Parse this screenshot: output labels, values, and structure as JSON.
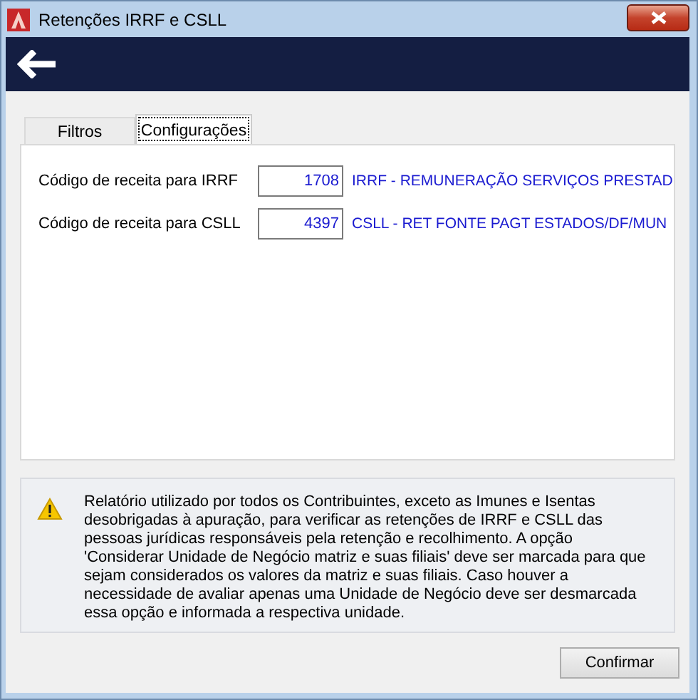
{
  "window": {
    "title": "Retenções IRRF e CSLL"
  },
  "tabs": [
    {
      "label": "Filtros",
      "selected": false
    },
    {
      "label": "Configurações",
      "selected": true
    }
  ],
  "fields": [
    {
      "label": "Código de receita para IRRF",
      "value": "1708",
      "description": "IRRF - REMUNERAÇÃO SERVIÇOS PRESTAD"
    },
    {
      "label": "Código de receita para CSLL",
      "value": "4397",
      "description": "CSLL - RET FONTE PAGT ESTADOS/DF/MUN"
    }
  ],
  "info": {
    "text": "Relatório utilizado por todos os Contribuintes, exceto as Imunes e Isentas desobrigadas à apuração, para verificar as retenções de IRRF e CSLL das pessoas jurídicas responsáveis pela retenção e recolhimento. A opção 'Considerar Unidade de Negócio matriz e suas filiais' deve ser marcada para que sejam considerados os valores da matriz e suas filiais. Caso houver a necessidade de avaliar apenas uma Unidade de Negócio deve ser desmarcada essa opção e informada a respectiva unidade."
  },
  "buttons": [
    "Confirmar"
  ]
}
